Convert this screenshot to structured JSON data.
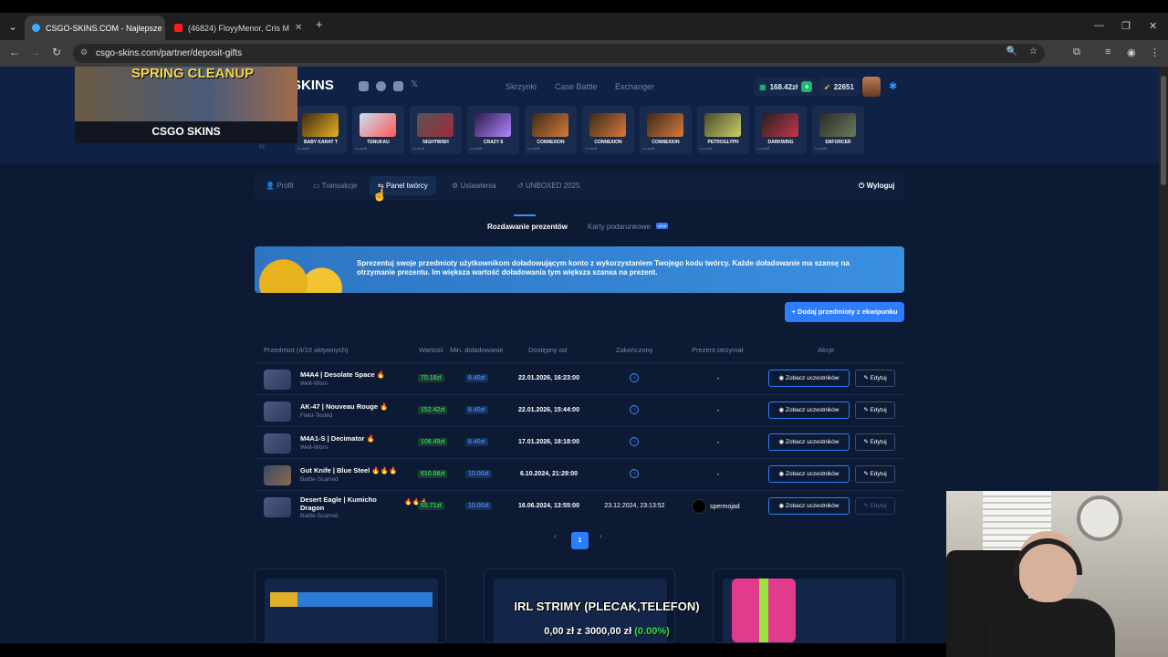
{
  "browser": {
    "tabs": [
      {
        "title": "CSGO-SKINS.COM - Najlepsze"
      },
      {
        "title": "(46824) FloyyMenor, Cris M"
      }
    ],
    "new_tab": "+",
    "url": "csgo-skins.com/partner/deposit-gifts"
  },
  "promo": {
    "title": "SPRING CLEANUP",
    "brand": "CSGO SKINS"
  },
  "header": {
    "logo": "SKINS",
    "nav": [
      "Skrzynki",
      "Case Battle",
      "Exchanger"
    ],
    "balance": "168.42zł",
    "points": "22651"
  },
  "live_drops": [
    {
      "name": "BABY KARAT T",
      "sub": "Lo stuff"
    },
    {
      "name": "TENUKAU",
      "sub": "Lo stuff"
    },
    {
      "name": "NIGHTWISH",
      "sub": "Lo stuff"
    },
    {
      "name": "CRAZY 8",
      "sub": "Lo stuff"
    },
    {
      "name": "CONNEXION",
      "sub": "Lo stuff"
    },
    {
      "name": "CONNEXION",
      "sub": "Lo stuff"
    },
    {
      "name": "CONNEXION",
      "sub": "Lo stuff"
    },
    {
      "name": "PETROGLYPH",
      "sub": "Lo stuff"
    },
    {
      "name": "DARKWING",
      "sub": "Lo stuff"
    },
    {
      "name": "ENFORCER",
      "sub": "Lo stuff"
    }
  ],
  "profile_tabs": {
    "profil": "Profil",
    "transakcje": "Transakcje",
    "panel": "Panel twórcy",
    "ustawienia": "Ustawienia",
    "unboxed": "UNBOXED 2025",
    "logout": "Wyloguj"
  },
  "subtabs": {
    "gifts": "Rozdawanie prezentów",
    "cards": "Karty podarunkowe",
    "new_badge": "NEW"
  },
  "banner": {
    "text": "Sprezentuj swoje przedmioty użytkownikom doładowującym konto z wykorzystaniem Twojego kodu twórcy. Każde doładowanie ma szansę na otrzymanie prezentu. Im większa wartość doładowania tym większa szansa na prezent."
  },
  "add_button": "Dodaj przedmioty z ekwipunku",
  "table": {
    "headers": {
      "item": "Przedmiot (4/10 aktywnych)",
      "value": "Wartość",
      "min_deposit": "Min. doładowanie",
      "available": "Dostępny od",
      "ended": "Zakończony",
      "winner": "Prezent otrzymał",
      "actions": "Akcje"
    },
    "view_label": "Zobacz uczestników",
    "edit_label": "Edytuj",
    "rows": [
      {
        "name": "M4A4 | Desolate Space",
        "flame": "🔥",
        "condition": "Well-Worn",
        "value": "70.18zł",
        "min": "8.40zł",
        "available": "22.01.2026, 16:23:00",
        "ended": "",
        "winner": "-"
      },
      {
        "name": "AK-47 | Nouveau Rouge",
        "flame": "🔥",
        "condition": "Field-Tested",
        "value": "152.42zł",
        "min": "8.40zł",
        "available": "22.01.2026, 15:44:00",
        "ended": "",
        "winner": "-"
      },
      {
        "name": "M4A1-S | Decimator",
        "flame": "🔥",
        "condition": "Well-Worn",
        "value": "108.49zł",
        "min": "8.40zł",
        "available": "17.01.2026, 18:18:00",
        "ended": "",
        "winner": "-"
      },
      {
        "name": "Gut Knife | Blue Steel",
        "flame": "🔥🔥🔥",
        "condition": "Battle-Scarred",
        "value": "610.68zł",
        "min": "10.00zł",
        "available": "6.10.2024, 21:29:00",
        "ended": "",
        "winner": "-"
      },
      {
        "name": "Desert Eagle | Kumicho Dragon",
        "flame": "🔥🔥🔥",
        "condition": "Battle-Scarred",
        "value": "65.71zł",
        "min": "10.00zł",
        "available": "16.06.2024, 13:55:00",
        "ended": "23.12.2024, 23:13:52",
        "winner": "spermojad"
      }
    ]
  },
  "pagination": {
    "prev": "‹",
    "current": "1",
    "next": "›"
  },
  "stream_overlay": {
    "line1": "IRL STRIMY (PLECAK,TELEFON)",
    "line2_prefix": "0,00 zł z 3000,00 zł",
    "line2_pct": "(0.00%)"
  },
  "colors": {
    "accent": "#2f7dff",
    "page_bg": "#0d1a33",
    "value_green": "#4ee08a"
  }
}
